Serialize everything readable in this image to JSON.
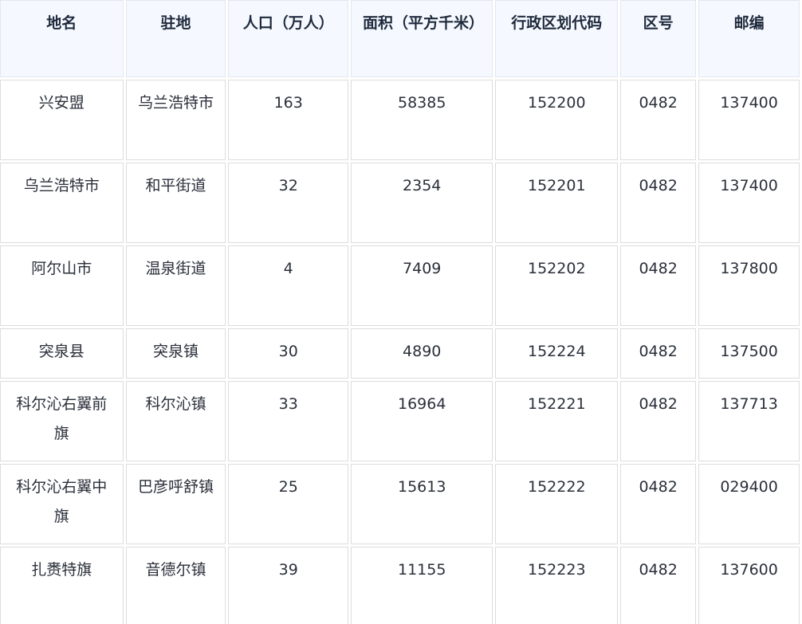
{
  "table": {
    "headers": [
      "地名",
      "驻地",
      "人口（万人）",
      "面积（平方千米）",
      "行政区划代码",
      "区号",
      "邮编"
    ],
    "rows": [
      [
        "兴安盟",
        "乌兰浩特市",
        "163",
        "58385",
        "152200",
        "0482",
        "137400"
      ],
      [
        "乌兰浩特市",
        "和平街道",
        "32",
        "2354",
        "152201",
        "0482",
        "137400"
      ],
      [
        "阿尔山市",
        "温泉街道",
        "4",
        "7409",
        "152202",
        "0482",
        "137800"
      ],
      [
        "突泉县",
        "突泉镇",
        "30",
        "4890",
        "152224",
        "0482",
        "137500"
      ],
      [
        "科尔沁右翼前旗",
        "科尔沁镇",
        "33",
        "16964",
        "152221",
        "0482",
        "137713"
      ],
      [
        "科尔沁右翼中旗",
        "巴彦呼舒镇",
        "25",
        "15613",
        "152222",
        "0482",
        "029400"
      ],
      [
        "扎赉特旗",
        "音德尔镇",
        "39",
        "11155",
        "152223",
        "0482",
        "137600"
      ]
    ]
  }
}
